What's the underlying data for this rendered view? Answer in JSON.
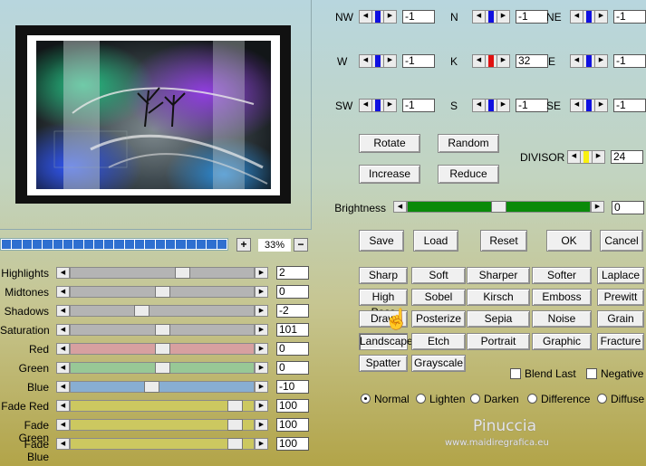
{
  "zoom": {
    "plus": "+",
    "minus": "−",
    "value": "33%"
  },
  "directions": [
    {
      "label": "NW",
      "value": "-1",
      "color": "#1010e0"
    },
    {
      "label": "N",
      "value": "-1",
      "color": "#1010e0"
    },
    {
      "label": "NE",
      "value": "-1",
      "color": "#1010e0"
    },
    {
      "label": "W",
      "value": "-1",
      "color": "#1010e0"
    },
    {
      "label": "K",
      "value": "32",
      "color": "#e01010"
    },
    {
      "label": "E",
      "value": "-1",
      "color": "#1010e0"
    },
    {
      "label": "SW",
      "value": "-1",
      "color": "#1010e0"
    },
    {
      "label": "S",
      "value": "-1",
      "color": "#1010e0"
    },
    {
      "label": "SE",
      "value": "-1",
      "color": "#1010e0"
    }
  ],
  "buttons": {
    "rotate": "Rotate",
    "random": "Random",
    "increase": "Increase",
    "reduce": "Reduce",
    "save": "Save",
    "load": "Load",
    "reset": "Reset",
    "ok": "OK",
    "cancel": "Cancel"
  },
  "divisor": {
    "label": "DIVISOR",
    "value": "24",
    "color": "#f8f010"
  },
  "brightness": {
    "label": "Brightness",
    "value": "0",
    "level": 0.5,
    "color": "#0a8a0a"
  },
  "adjustments": [
    {
      "label": "Highlights",
      "value": "2",
      "pos": 0.62,
      "color": "#b4b4b4"
    },
    {
      "label": "Midtones",
      "value": "0",
      "pos": 0.5,
      "color": "#b4b4b4"
    },
    {
      "label": "Shadows",
      "value": "-2",
      "pos": 0.38,
      "color": "#b4b4b4"
    },
    {
      "label": "Saturation",
      "value": "101",
      "pos": 0.5,
      "color": "#b4b4b4"
    },
    {
      "label": "Red",
      "value": "0",
      "pos": 0.5,
      "color": "#d7a0a0"
    },
    {
      "label": "Green",
      "value": "0",
      "pos": 0.5,
      "color": "#98c896"
    },
    {
      "label": "Blue",
      "value": "-10",
      "pos": 0.44,
      "color": "#88aed2"
    },
    {
      "label": "Fade Red",
      "value": "100",
      "pos": 0.93,
      "color": "#ccc860"
    },
    {
      "label": "Fade Green",
      "value": "100",
      "pos": 0.93,
      "color": "#ccc860"
    },
    {
      "label": "Fade Blue",
      "value": "100",
      "pos": 0.93,
      "color": "#ccc860"
    }
  ],
  "presets": [
    "Sharp",
    "Soft",
    "Sharper",
    "Softer",
    "Laplace",
    "High Pass",
    "Sobel",
    "Kirsch",
    "Emboss",
    "Prewitt",
    "Draw",
    "Posterize",
    "Sepia",
    "Noise",
    "Grain",
    "Landscape",
    "Etch",
    "Portrait",
    "Graphic",
    "Fracture",
    "Spatter",
    "Grayscale"
  ],
  "checkboxes": {
    "blend_last": "Blend Last",
    "negative": "Negative"
  },
  "modes": [
    "Normal",
    "Lighten",
    "Darken",
    "Difference",
    "Diffuse"
  ],
  "selected_mode": "Normal",
  "signature": {
    "name": "Pinuccia",
    "site": "www.maidiregrafica.eu"
  }
}
